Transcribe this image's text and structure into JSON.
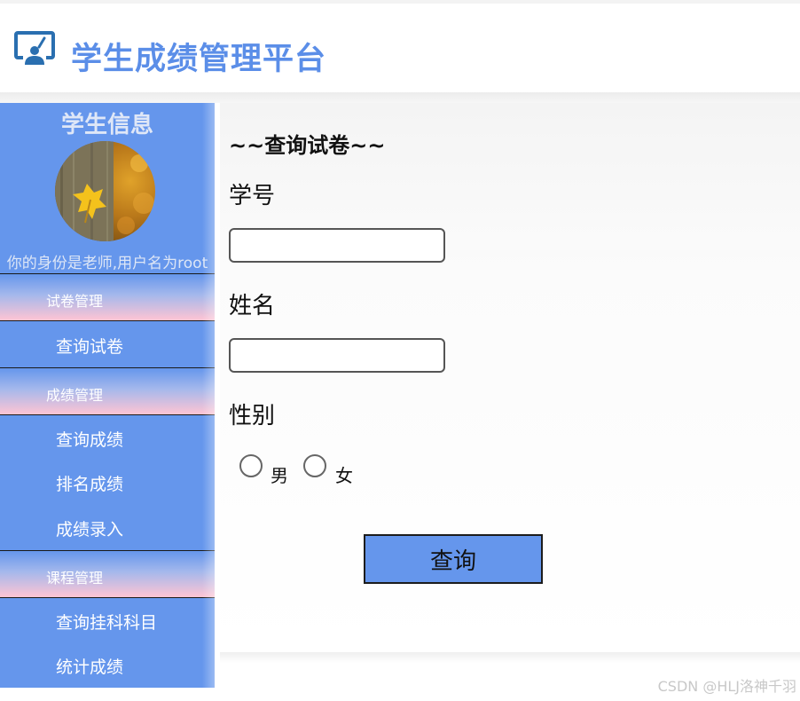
{
  "header": {
    "title": "学生成绩管理平台",
    "logo_icon": "presentation-board-icon"
  },
  "sidebar": {
    "title": "学生信息",
    "avatar": "autumn-leaf-avatar",
    "identity_text": "你的身份是老师,用户名为root",
    "groups": [
      {
        "label": "试卷管理",
        "items": [
          "查询试卷"
        ]
      },
      {
        "label": "成绩管理",
        "items": [
          "查询成绩",
          "排名成绩",
          "成绩录入"
        ]
      },
      {
        "label": "课程管理",
        "items": [
          "查询挂科科目",
          "统计成绩"
        ]
      }
    ]
  },
  "form": {
    "title": "~~查询试卷~~",
    "student_id_label": "学号",
    "student_id_value": "",
    "name_label": "姓名",
    "name_value": "",
    "gender_label": "性别",
    "gender_options": [
      "男",
      "女"
    ],
    "submit_label": "查询"
  },
  "watermark": "CSDN @HLJ洛神千羽",
  "colors": {
    "accent": "#6596ec",
    "title": "#5b8ee8",
    "menu_group_end": "#ffc4d3"
  }
}
